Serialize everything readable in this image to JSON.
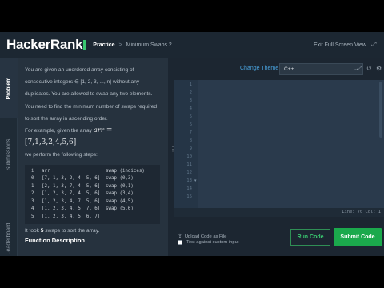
{
  "header": {
    "logo": "HackerRank",
    "section": "Practice",
    "separator": ">",
    "page": "Minimum Swaps 2",
    "fullscreen_label": "Exit Full Screen View",
    "expand_icon": "expand-icon"
  },
  "vtabs": {
    "problem": "Problem",
    "submissions": "Submissions",
    "leaderboard": "Leaderboard"
  },
  "problem": {
    "para1": "You are given an unordered array consisting of consecutive integers ∈ [1, 2, 3, ..., n] without any duplicates. You are allowed to swap any two elements. You need to find the minimum number of swaps required to sort the array in ascending order.",
    "example_prefix": "For example, given the array ",
    "example_var": "arr",
    "example_eq": " = ",
    "example_value": "[7,1,3,2,4,5,6]",
    "steps_text": "we perform the following steps:",
    "table": {
      "headers": [
        "i",
        "arr",
        "swap (indices)"
      ],
      "rows": [
        [
          "0",
          "[7, 1, 3, 2, 4, 5, 6]",
          "swap (0,3)"
        ],
        [
          "1",
          "[2, 1, 3, 7, 4, 5, 6]",
          "swap (0,1)"
        ],
        [
          "2",
          "[1, 2, 3, 7, 4, 5, 6]",
          "swap (3,4)"
        ],
        [
          "3",
          "[1, 2, 3, 4, 7, 5, 6]",
          "swap (4,5)"
        ],
        [
          "4",
          "[1, 2, 3, 4, 5, 7, 6]",
          "swap (5,6)"
        ],
        [
          "5",
          "[1, 2, 3, 4, 5, 6, 7]",
          ""
        ]
      ]
    },
    "took_prefix": "It took ",
    "took_count": "5",
    "took_suffix": " swaps to sort the array.",
    "function_description": "Function Description"
  },
  "toolbar": {
    "change_theme": "Change Theme",
    "language": "C++",
    "icons": [
      "fullscreen-icon",
      "history-icon",
      "settings-icon"
    ]
  },
  "editor": {
    "line_numbers": [
      "1",
      "2",
      "3",
      "4",
      "5",
      "6",
      "7",
      "8",
      "9",
      "10",
      "11",
      "12",
      "13",
      "14",
      "15"
    ],
    "status": "Line: 70 Col: 1"
  },
  "actions": {
    "upload_label": "Upload Code as File",
    "custom_input_label": "Test against custom input",
    "run_label": "Run Code",
    "submit_label": "Submit Code"
  },
  "colors": {
    "brand_green": "#39c76f",
    "submit_green": "#1ba94c",
    "link_blue": "#4aa4e0",
    "keyword_orange": "#f9a23c",
    "selection_blue": "#3d5a85"
  }
}
